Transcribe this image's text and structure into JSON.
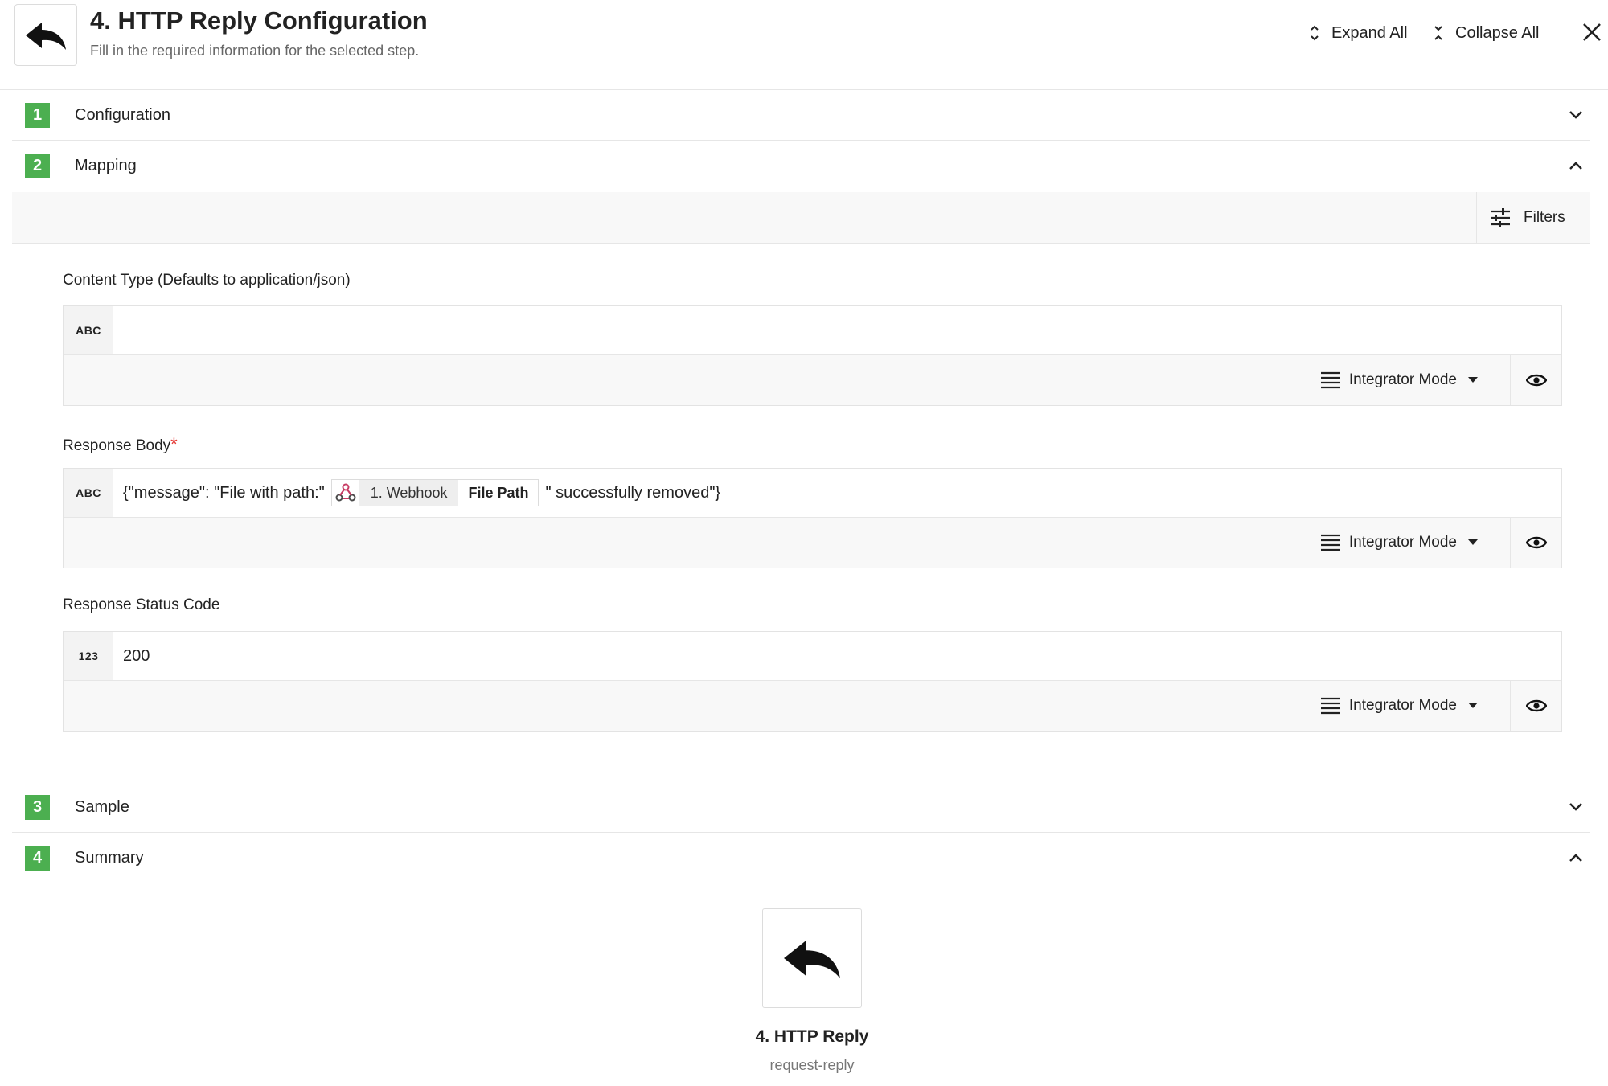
{
  "header": {
    "title": "4. HTTP Reply Configuration",
    "subtitle": "Fill in the required information for the selected step.",
    "icon": "reply-icon",
    "expand_all": "Expand All",
    "collapse_all": "Collapse All"
  },
  "sections": [
    {
      "number": "1",
      "label": "Configuration",
      "state": "collapsed"
    },
    {
      "number": "2",
      "label": "Mapping",
      "state": "expanded"
    },
    {
      "number": "3",
      "label": "Sample",
      "state": "collapsed"
    },
    {
      "number": "4",
      "label": "Summary",
      "state": "expanded"
    }
  ],
  "filters": {
    "label": "Filters"
  },
  "fields": [
    {
      "label": "Content Type (Defaults to application/json)",
      "type": "ABC",
      "value": "",
      "required": false,
      "mode": "Integrator Mode"
    },
    {
      "label": "Response Body",
      "type": "ABC",
      "required": true,
      "required_mark": "*",
      "value_prefix": "{\"message\": \"File with path:\"",
      "token": {
        "step": "1. Webhook",
        "field": "File Path",
        "icon": "webhook-icon"
      },
      "value_suffix": "\" successfully removed\"}",
      "mode": "Integrator Mode"
    },
    {
      "label": "Response Status Code",
      "type": "123",
      "value": "200",
      "required": false,
      "mode": "Integrator Mode"
    }
  ],
  "summary": {
    "title": "4. HTTP Reply",
    "subtitle": "request-reply",
    "icon": "reply-icon"
  },
  "colors": {
    "step_badge": "#4caf50",
    "required": "#e53935",
    "webhook_icon": "#c73a63"
  }
}
